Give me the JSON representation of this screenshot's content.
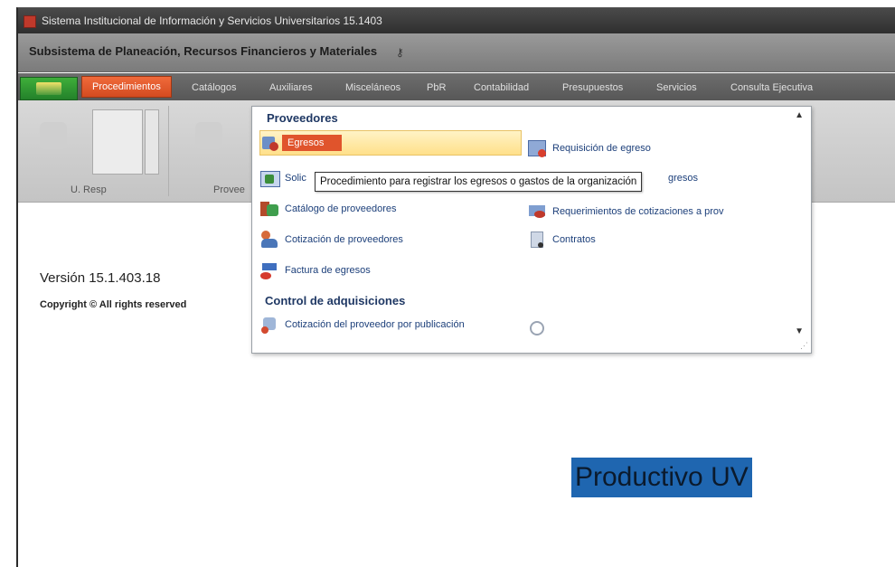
{
  "window": {
    "title": "Sistema Institucional de Información y Servicios Universitarios 15.1403"
  },
  "subsystem": {
    "title": "Subsistema de Planeación, Recursos Financieros y Materiales"
  },
  "tabs": [
    {
      "label": "Procedimientos",
      "active": true
    },
    {
      "label": "Catálogos"
    },
    {
      "label": "Auxiliares"
    },
    {
      "label": "Misceláneos"
    },
    {
      "label": "PbR"
    },
    {
      "label": "Contabilidad"
    },
    {
      "label": "Presupuestos"
    },
    {
      "label": "Servicios"
    },
    {
      "label": "Consulta Ejecutiva"
    }
  ],
  "ribbon": {
    "groups": [
      {
        "label": "U. Resp"
      },
      {
        "label": "Provee"
      }
    ]
  },
  "menu": {
    "sections": [
      {
        "title": "Proveedores"
      },
      {
        "title": "Control de adquisiciones"
      }
    ],
    "items": [
      {
        "label": "Egresos",
        "icon": "egresos-icon"
      },
      {
        "label": "Requisición de egreso",
        "icon": "requisicion-icon"
      },
      {
        "label": "Solic",
        "icon": "solicitud-icon"
      },
      {
        "label": "gresos",
        "icon": "egresos-list-icon"
      },
      {
        "label": "Catálogo de proveedores",
        "icon": "catalogo-icon"
      },
      {
        "label": "Requerimientos de cotizaciones a prov",
        "icon": "requerimientos-icon"
      },
      {
        "label": "Cotización de proveedores",
        "icon": "cotizacion-icon"
      },
      {
        "label": "Contratos",
        "icon": "contratos-icon"
      },
      {
        "label": "Factura de egresos",
        "icon": "factura-icon"
      },
      {
        "label": "Cotización del proveedor por publicación",
        "icon": "publicacion-icon"
      }
    ],
    "tooltip": "Procedimiento para registrar los egresos o gastos de la organización"
  },
  "footer": {
    "version": "Versión 15.1.403.18",
    "copyright": "Copyright © All rights reserved"
  },
  "environment": {
    "label": "Productivo UV",
    "background": "#1f66b0"
  }
}
